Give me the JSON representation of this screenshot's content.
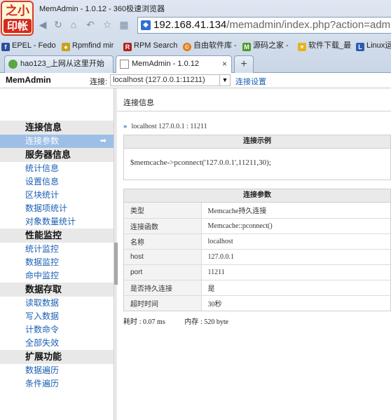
{
  "browser": {
    "logo_line1": "之小",
    "logo_line2": "印帐",
    "window_title": "MemAdmin - 1.0.12 - 360极速浏览器",
    "url_host": "192.168.41.134",
    "url_path": "/memadmin/index.php?action=admin",
    "bookmarks": [
      {
        "label": "EPEL - Fedo",
        "icon": "fedora-icon",
        "color": "#2a4f9c"
      },
      {
        "label": "Rpmfind mir",
        "icon": "rpmfind-icon",
        "color": "#c8a21a"
      },
      {
        "label": "RPM Search",
        "icon": "rpm-icon",
        "color": "#b2231f"
      },
      {
        "label": "自由软件库 -",
        "icon": "freesoft-icon",
        "color": "#e07b12"
      },
      {
        "label": "源码之家 -",
        "icon": "mcode-icon",
        "color": "#4a9b2a"
      },
      {
        "label": "软件下载_最",
        "icon": "download-icon",
        "color": "#e7b31c"
      },
      {
        "label": "Linux运",
        "icon": "linux-icon",
        "color": "#2a5db0"
      }
    ],
    "tabs": [
      {
        "label": "hao123_上网从这里开始"
      },
      {
        "label": "MemAdmin - 1.0.12",
        "close": "×"
      }
    ],
    "new_tab": "+"
  },
  "app": {
    "brand": "MemAdmin",
    "connection_label": "连接:",
    "connection_value": "localhost (127.0.0.1:11211)",
    "settings_link": "连接设置"
  },
  "sidebar": {
    "groups": [
      {
        "title": "连接信息",
        "items": [
          {
            "label": "连接参数",
            "active": true
          }
        ]
      },
      {
        "title": "服务器信息",
        "items": [
          {
            "label": "统计信息"
          },
          {
            "label": "设置信息"
          },
          {
            "label": "区块统计"
          },
          {
            "label": "数据项统计"
          },
          {
            "label": "对象数量统计"
          }
        ]
      },
      {
        "title": "性能监控",
        "items": [
          {
            "label": "统计监控"
          },
          {
            "label": "数据监控"
          },
          {
            "label": "命中监控"
          }
        ]
      },
      {
        "title": "数据存取",
        "items": [
          {
            "label": "读取数据"
          },
          {
            "label": "写入数据"
          },
          {
            "label": "计数命令"
          },
          {
            "label": "全部失效"
          }
        ]
      },
      {
        "title": "扩展功能",
        "items": [
          {
            "label": "数据遍历"
          },
          {
            "label": "条件遍历"
          }
        ]
      }
    ]
  },
  "main": {
    "title": "连接信息",
    "server": "localhost 127.0.0.1 : 11211",
    "example_title": "连接示例",
    "example_code": "$memcache->pconnect('127.0.0.1',11211,30);",
    "params_title": "连接参数",
    "params": [
      {
        "key": "类型",
        "value": "Memcache持久连接"
      },
      {
        "key": "连接函数",
        "value": "Memcache::pconnect()"
      },
      {
        "key": "名称",
        "value": "localhost"
      },
      {
        "key": "host",
        "value": "127.0.0.1"
      },
      {
        "key": "port",
        "value": "11211"
      },
      {
        "key": "是否持久连接",
        "value": "是"
      },
      {
        "key": "超时时间",
        "value": "30秒"
      }
    ],
    "time_label": "耗时",
    "time_value": ": 0.07 ms",
    "memory_label": "内存",
    "memory_value": ": 520 byte"
  }
}
